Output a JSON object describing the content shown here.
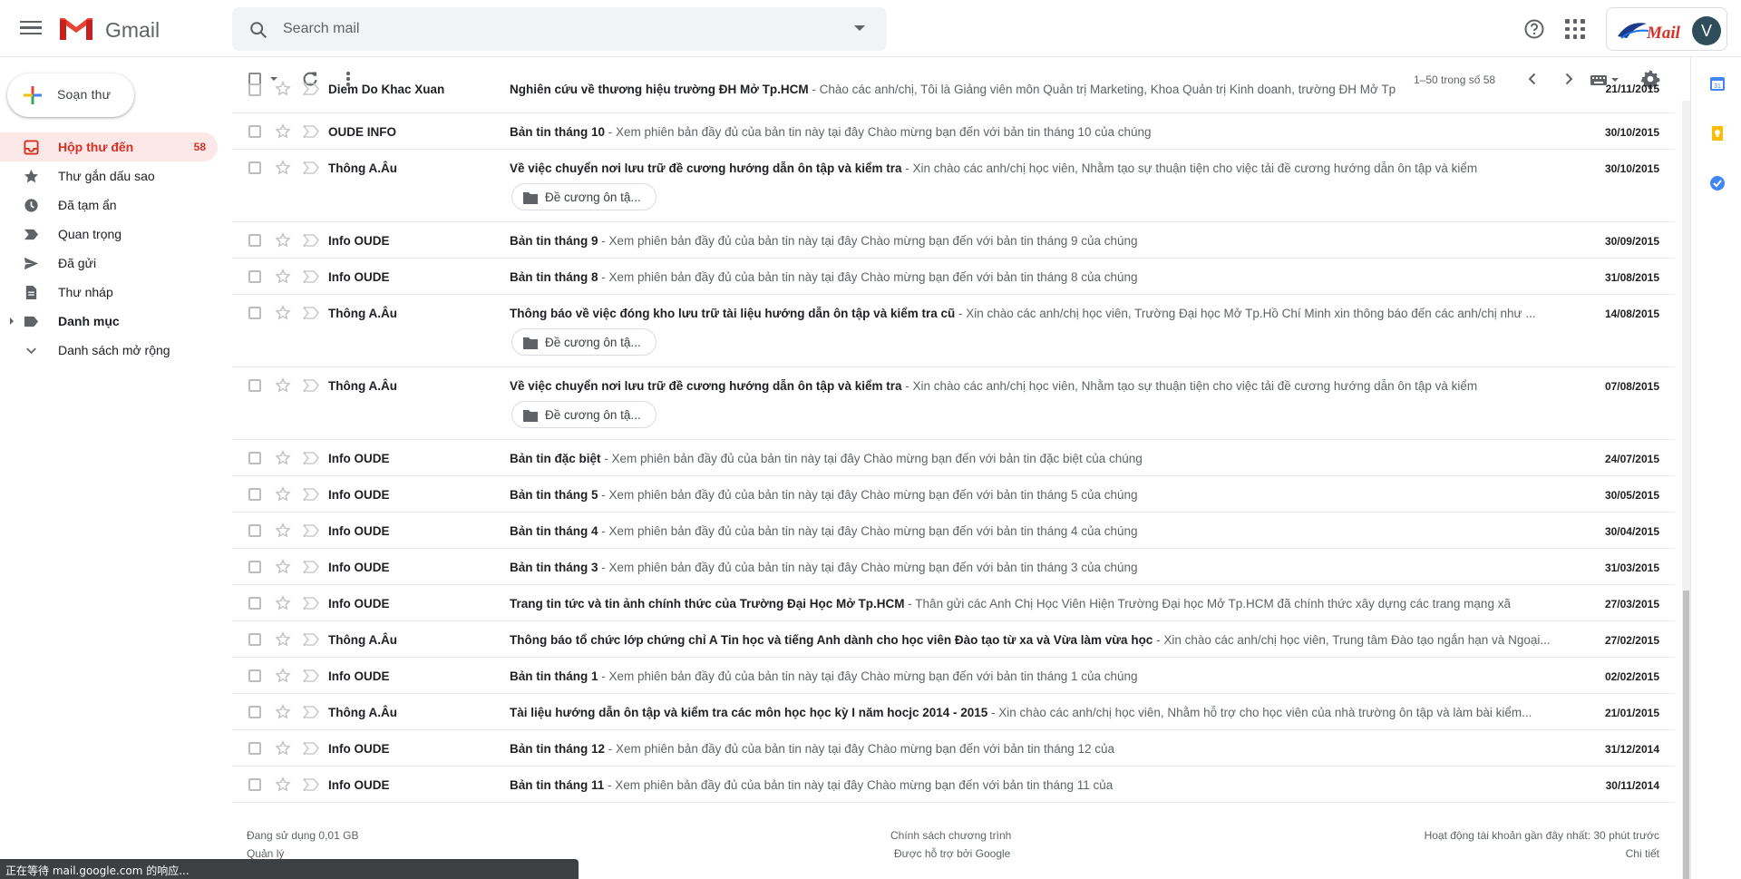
{
  "header": {
    "app_name": "Gmail",
    "search_placeholder": "Search mail",
    "avatar_letter": "V",
    "brand_text": "Mail"
  },
  "compose": {
    "label": "Soạn thư"
  },
  "sidebar": {
    "items": [
      {
        "label": "Hộp thư đến",
        "count": "58",
        "icon": "inbox-icon",
        "active": true
      },
      {
        "label": "Thư gắn dấu sao",
        "icon": "star-icon"
      },
      {
        "label": "Đã tạm ẩn",
        "icon": "clock-icon"
      },
      {
        "label": "Quan trọng",
        "icon": "important-icon"
      },
      {
        "label": "Đã gửi",
        "icon": "send-icon"
      },
      {
        "label": "Thư nháp",
        "icon": "draft-icon"
      },
      {
        "label": "Danh mục",
        "icon": "label-icon"
      },
      {
        "label": "Danh sách mở rộng",
        "icon": "chevron-down-icon"
      }
    ]
  },
  "toolbar": {
    "pager_text": "1–50 trong số 58"
  },
  "emails": [
    {
      "sender": "Diem Do Khac Xuan",
      "subject": "Nghiên cứu về thương hiệu trường ĐH Mở Tp.HCM",
      "snippet": " - Chào các anh/chị, Tôi là Giảng viên môn Quản trị Marketing, Khoa Quản trị Kinh doanh, trường ĐH Mở Tp",
      "date": "21/11/2015"
    },
    {
      "sender": "OUDE INFO",
      "subject": "Bản tin tháng 10",
      "snippet": " - Xem phiên bản đầy đủ của bản tin này tại đây Chào mừng bạn đến với bản tin tháng 10 của chúng",
      "date": "30/10/2015"
    },
    {
      "sender": "Thông A.Âu",
      "subject": "Về việc chuyển nơi lưu trữ đề cương hướng dẫn ôn tập và kiểm tra",
      "snippet": " - Xin chào các anh/chị học viên, Nhằm tạo sự thuận tiện cho việc tải đề cương hướng dẫn ôn tập và kiểm",
      "date": "30/10/2015",
      "attachment": "Đề cương ôn tậ..."
    },
    {
      "sender": "Info OUDE",
      "subject": "Bản tin tháng 9",
      "snippet": " - Xem phiên bản đầy đủ của bản tin này tại đây Chào mừng bạn đến với bản tin tháng 9 của chúng",
      "date": "30/09/2015"
    },
    {
      "sender": "Info OUDE",
      "subject": "Bản tin tháng 8",
      "snippet": " - Xem phiên bản đầy đủ của bản tin này tại đây Chào mừng bạn đến với bản tin tháng 8 của chúng",
      "date": "31/08/2015"
    },
    {
      "sender": "Thông A.Âu",
      "subject": "Thông báo về việc đóng kho lưu trữ tài liệu hướng dẫn ôn tập và kiểm tra cũ",
      "snippet": " - Xin chào các anh/chị học viên, Trường Đại học Mở Tp.Hồ Chí Minh xin thông báo đến các anh/chị như ...",
      "date": "14/08/2015",
      "attachment": "Đề cương ôn tậ..."
    },
    {
      "sender": "Thông A.Âu",
      "subject": "Về việc chuyển nơi lưu trữ đề cương hướng dẫn ôn tập và kiểm tra",
      "snippet": " - Xin chào các anh/chị học viên, Nhằm tạo sự thuận tiện cho việc tải đề cương hướng dẫn ôn tập và kiểm",
      "date": "07/08/2015",
      "attachment": "Đề cương ôn tậ..."
    },
    {
      "sender": "Info OUDE",
      "subject": "Bản tin đặc biệt",
      "snippet": " - Xem phiên bản đầy đủ của bản tin này tại đây Chào mừng bạn đến với bản tin đặc biệt của chúng",
      "date": "24/07/2015"
    },
    {
      "sender": "Info OUDE",
      "subject": "Bản tin tháng 5",
      "snippet": " - Xem phiên bản đầy đủ của bản tin này tại đây Chào mừng bạn đến với bản tin tháng 5 của chúng",
      "date": "30/05/2015"
    },
    {
      "sender": "Info OUDE",
      "subject": "Bản tin tháng 4",
      "snippet": " - Xem phiên bản đầy đủ của bản tin này tại đây Chào mừng bạn đến với bản tin tháng 4 của chúng",
      "date": "30/04/2015"
    },
    {
      "sender": "Info OUDE",
      "subject": "Bản tin tháng 3",
      "snippet": " - Xem phiên bản đầy đủ của bản tin này tại đây Chào mừng bạn đến với bản tin tháng 3 của chúng",
      "date": "31/03/2015"
    },
    {
      "sender": "Info OUDE",
      "subject": "Trang tin tức và tin ảnh chính thức của Trường Đại Học Mở Tp.HCM",
      "snippet": " - Thân gửi các Anh Chị Học Viên Hiện Trường Đại học Mở Tp.HCM đã chính thức xây dựng các trang mạng xã",
      "date": "27/03/2015"
    },
    {
      "sender": "Thông A.Âu",
      "subject": "Thông báo tổ chức lớp chứng chỉ A Tin học và tiếng Anh dành cho học viên Đào tạo từ xa và Vừa làm vừa học",
      "snippet": " - Xin chào các anh/chị học viên, Trung tâm Đào tạo ngắn hạn và Ngoại...",
      "date": "27/02/2015"
    },
    {
      "sender": "Info OUDE",
      "subject": "Bản tin tháng 1",
      "snippet": " - Xem phiên bản đầy đủ của bản tin này tại đây Chào mừng bạn đến với bản tin tháng 1 của chúng",
      "date": "02/02/2015"
    },
    {
      "sender": "Thông A.Âu",
      "subject": "Tài liệu hướng dẫn ôn tập và kiểm tra các môn học học kỳ I năm hocjc 2014 - 2015",
      "snippet": " - Xin chào các anh/chị học viên, Nhằm hỗ trợ cho học viên của nhà trường ôn tập và làm bài kiểm...",
      "date": "21/01/2015"
    },
    {
      "sender": "Info OUDE",
      "subject": "Bản tin tháng 12",
      "snippet": " - Xem phiên bản đầy đủ của bản tin này tại đây Chào mừng bạn đến với bản tin tháng 12 của",
      "date": "31/12/2014"
    },
    {
      "sender": "Info OUDE",
      "subject": "Bản tin tháng 11",
      "snippet": " - Xem phiên bản đầy đủ của bản tin này tại đây Chào mừng bạn đến với bản tin tháng 11 của",
      "date": "30/11/2014"
    }
  ],
  "footer": {
    "storage": "Đang sử dụng 0,01 GB",
    "manage": "Quản lý",
    "policy": "Chính sách chương trình",
    "powered": "Được hỗ trợ bởi Google",
    "activity": "Hoạt động tài khoản gần đây nhất: 30 phút trước",
    "details": "Chi tiết"
  },
  "statusbar": {
    "text": "正在等待 mail.google.com 的响应..."
  },
  "colors": {
    "accent_red": "#d93025",
    "active_bg": "#fce8e6"
  }
}
